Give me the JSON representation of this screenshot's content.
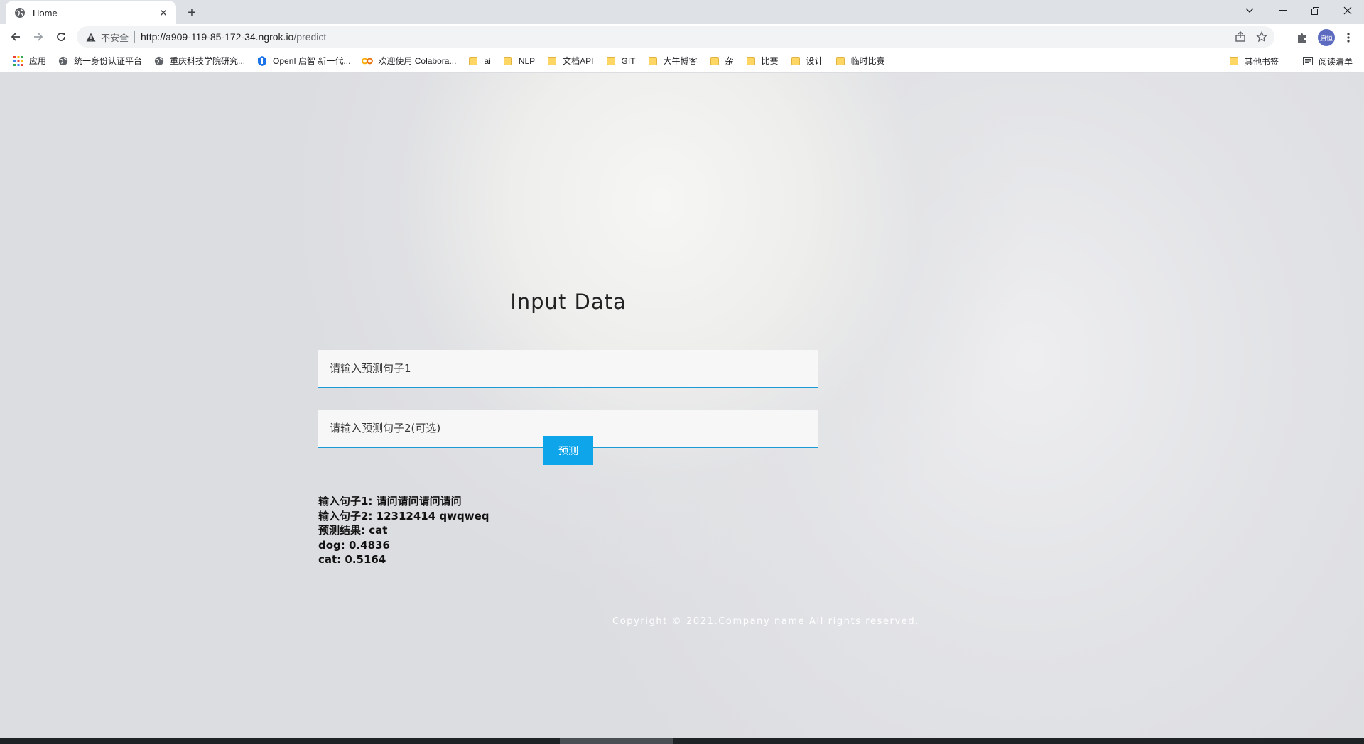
{
  "browser": {
    "tab": {
      "title": "Home",
      "favicon": "globe-icon"
    },
    "toolbar": {
      "security_label": "不安全",
      "url_base": "http://a909-119-85-172-34.ngrok.io",
      "url_path": "/predict",
      "profile_initials": "启恒"
    },
    "bookmarks": [
      {
        "label": "应用",
        "icon": "apps-grid-icon"
      },
      {
        "label": "统一身份认证平台",
        "icon": "globe-icon"
      },
      {
        "label": "重庆科技学院研究...",
        "icon": "globe-icon"
      },
      {
        "label": "OpenI 启智 新一代...",
        "icon": "openi-icon"
      },
      {
        "label": "欢迎使用 Colabora...",
        "icon": "colab-icon"
      },
      {
        "label": "ai",
        "icon": "folder-icon"
      },
      {
        "label": "NLP",
        "icon": "folder-icon"
      },
      {
        "label": "文档API",
        "icon": "folder-icon"
      },
      {
        "label": "GIT",
        "icon": "folder-icon"
      },
      {
        "label": "大牛博客",
        "icon": "folder-icon"
      },
      {
        "label": "杂",
        "icon": "folder-icon"
      },
      {
        "label": "比赛",
        "icon": "folder-icon"
      },
      {
        "label": "设计",
        "icon": "folder-icon"
      },
      {
        "label": "临时比赛",
        "icon": "folder-icon"
      }
    ],
    "other_bookmarks": "其他书签",
    "reading_list": "阅读清单"
  },
  "page": {
    "title": "Input Data",
    "sentence1_placeholder": "请输入预测句子1",
    "sentence2_placeholder": "请输入预测句子2(可选)",
    "predict_button": "预测",
    "results": {
      "line1": "输入句子1: 请问请问请问请问",
      "line2": "输入句子2: 12312414 qwqweq",
      "line3": "预测结果: cat",
      "line4": "dog: 0.4836",
      "line5": "cat: 0.5164"
    },
    "footer": "Copyright © 2021.Company name All rights reserved."
  },
  "colors": {
    "accent": "#0ea5ea",
    "field_underline": "#1c9ad6"
  }
}
